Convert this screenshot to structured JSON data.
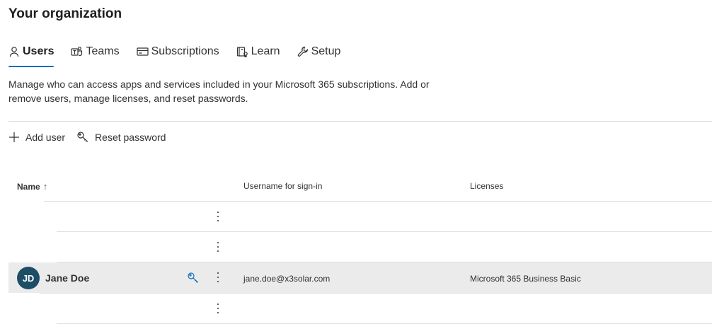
{
  "page": {
    "title": "Your organization"
  },
  "tabs": [
    {
      "label": "Users",
      "icon": "person-icon",
      "active": true
    },
    {
      "label": "Teams",
      "icon": "teams-icon"
    },
    {
      "label": "Subscriptions",
      "icon": "subscription-card-icon"
    },
    {
      "label": "Learn",
      "icon": "learn-book-icon"
    },
    {
      "label": "Setup",
      "icon": "wrench-icon"
    }
  ],
  "description": "Manage who can access apps and services included in your Microsoft 365 subscriptions. Add or remove users, manage licenses, and reset passwords.",
  "commands": {
    "add_user": "Add user",
    "reset_password": "Reset password"
  },
  "table": {
    "columns": {
      "name": "Name",
      "username": "Username for sign-in",
      "licenses": "Licenses"
    },
    "sort": "ascending",
    "rows": [
      {
        "name": "",
        "initials": "",
        "username": "",
        "licenses": ""
      },
      {
        "name": "",
        "initials": "",
        "username": "",
        "licenses": ""
      },
      {
        "name": "Jane Doe",
        "initials": "JD",
        "username": "jane.doe@x3solar.com",
        "licenses": "Microsoft 365 Business Basic",
        "selected": true
      },
      {
        "name": "",
        "initials": "",
        "username": "",
        "licenses": ""
      }
    ]
  },
  "colors": {
    "accent": "#0f6cbd",
    "avatar": "#1e4d66",
    "selected_row": "#ebebeb"
  }
}
